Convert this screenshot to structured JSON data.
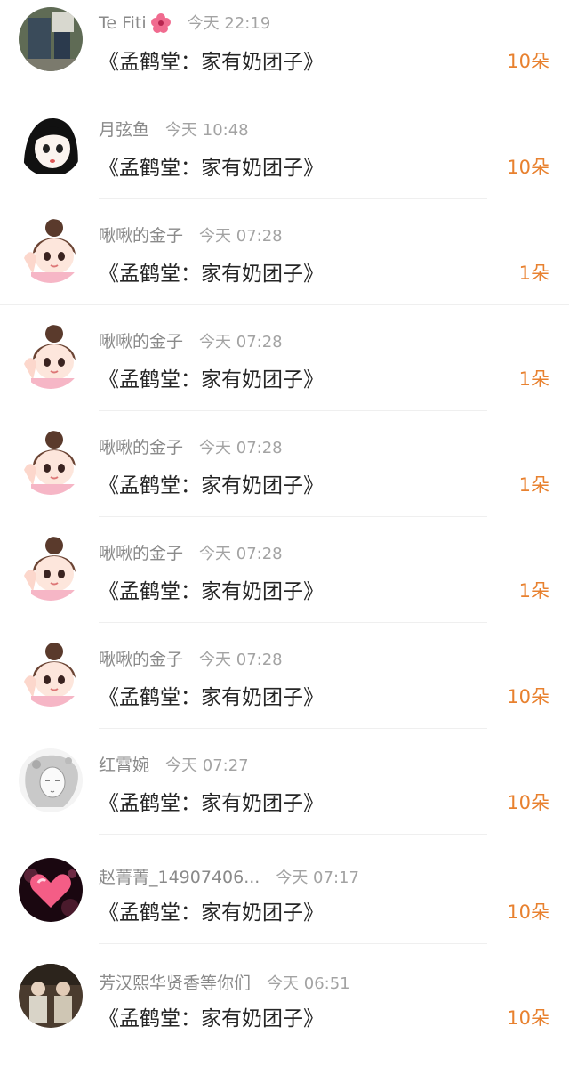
{
  "items": [
    {
      "name": "Te Fiti",
      "badge": "flower-icon",
      "time": "今天 22:19",
      "title": "《孟鹤堂：家有奶团子》",
      "count": "10朵",
      "avatar": "avatar-photo-person"
    },
    {
      "name": "月弦鱼",
      "time": "今天 10:48",
      "title": "《孟鹤堂：家有奶团子》",
      "count": "10朵",
      "avatar": "avatar-anime-girl"
    },
    {
      "name": "啾啾的金子",
      "time": "今天 07:28",
      "title": "《孟鹤堂：家有奶团子》",
      "count": "1朵",
      "avatar": "avatar-cartoon-girl"
    },
    {
      "name": "啾啾的金子",
      "time": "今天 07:28",
      "title": "《孟鹤堂：家有奶团子》",
      "count": "1朵",
      "avatar": "avatar-cartoon-girl"
    },
    {
      "name": "啾啾的金子",
      "time": "今天 07:28",
      "title": "《孟鹤堂：家有奶团子》",
      "count": "1朵",
      "avatar": "avatar-cartoon-girl"
    },
    {
      "name": "啾啾的金子",
      "time": "今天 07:28",
      "title": "《孟鹤堂：家有奶团子》",
      "count": "1朵",
      "avatar": "avatar-cartoon-girl"
    },
    {
      "name": "啾啾的金子",
      "time": "今天 07:28",
      "title": "《孟鹤堂：家有奶团子》",
      "count": "10朵",
      "avatar": "avatar-cartoon-girl"
    },
    {
      "name": "红霄婉",
      "time": "今天 07:27",
      "title": "《孟鹤堂：家有奶团子》",
      "count": "10朵",
      "avatar": "avatar-sketch-lady"
    },
    {
      "name": "赵菁菁_14907406...",
      "time": "今天 07:17",
      "title": "《孟鹤堂：家有奶团子》",
      "count": "10朵",
      "avatar": "avatar-pink-heart"
    },
    {
      "name": "芳汉熙华贤香等你们",
      "time": "今天 06:51",
      "title": "《孟鹤堂：家有奶团子》",
      "count": "10朵",
      "avatar": "avatar-photo-group"
    }
  ],
  "colors": {
    "count": "#e8812f",
    "name": "#8a8a8a",
    "time": "#a3a3a3",
    "title": "#262626"
  }
}
